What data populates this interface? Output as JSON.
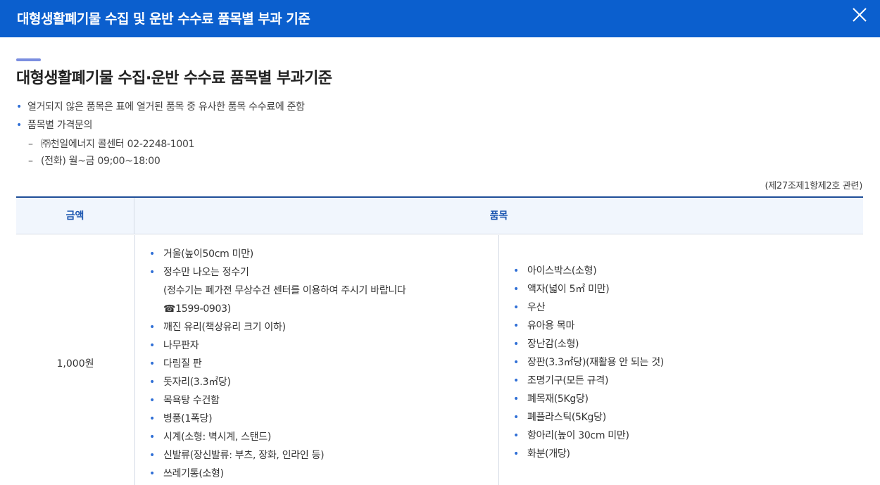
{
  "modal": {
    "title": "대형생활폐기물 수집 및 운반 수수료 품목별 부과 기준"
  },
  "page": {
    "title": "대형생활폐기물 수집·운반 수수료 품목별 부과기준",
    "notes": [
      "열거되지 않은 품목은 표에 열거된 품목 중 유사한 품목 수수료에 준함",
      "품목별 가격문의"
    ],
    "subnotes": [
      "㈜천일에너지 콜센터 02-2248-1001",
      "(전화) 월~금 09;00~18:00"
    ],
    "reference": "(제27조제1항제2호 관련)"
  },
  "table": {
    "headers": {
      "price": "금액",
      "items": "품목"
    },
    "rows": [
      {
        "price": "1,000원",
        "left_items": [
          {
            "text": "거울(높이50cm 미만)",
            "bullet": true
          },
          {
            "text": "정수만 나오는 정수기",
            "bullet": true
          },
          {
            "text": "(정수기는 폐가전 무상수건 센터를 이용하여 주시기 바랍니다",
            "bullet": false
          },
          {
            "text": "☎1599-0903)",
            "bullet": false
          },
          {
            "text": "깨진 유리(책상유리 크기 이하)",
            "bullet": true
          },
          {
            "text": "나무판자",
            "bullet": true
          },
          {
            "text": "다림질 판",
            "bullet": true
          },
          {
            "text": "돗자리(3.3㎡당)",
            "bullet": true
          },
          {
            "text": "목욕탕 수건함",
            "bullet": true
          },
          {
            "text": "병풍(1폭당)",
            "bullet": true
          },
          {
            "text": "시계(소형: 벽시계, 스탠드)",
            "bullet": true
          },
          {
            "text": "신발류(장신발류: 부츠, 장화, 인라인 등)",
            "bullet": true
          },
          {
            "text": "쓰레기통(소형)",
            "bullet": true
          }
        ],
        "right_items": [
          "아이스박스(소형)",
          "액자(넓이 5㎡ 미만)",
          "우산",
          "유아용 목마",
          "장난감(소형)",
          "장판(3.3㎡당)(재활용 안 되는 것)",
          "조명기구(모든 규격)",
          "폐목재(5Kg당)",
          "폐플라스틱(5Kg당)",
          "항아리(높이 30cm 미만)",
          "화분(개당)"
        ]
      }
    ]
  },
  "icons": {
    "close": "close-icon",
    "bullet": "bullet-dot-icon"
  },
  "colors": {
    "header_bg": "#0b5fce",
    "table_head_bg": "#f1f6fd",
    "accent_blue": "#2f6fd6"
  }
}
